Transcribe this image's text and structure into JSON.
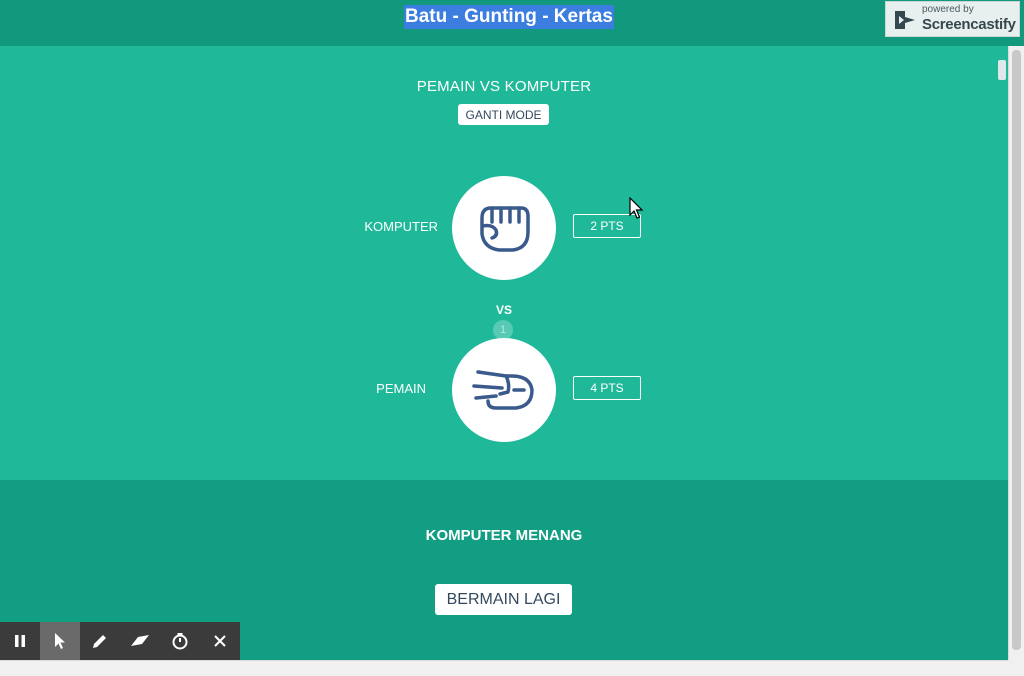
{
  "app": {
    "title": "Batu - Gunting - Kertas"
  },
  "screencastify": {
    "powered_by": "powered by",
    "name": "Screencastify"
  },
  "game": {
    "mode_title": "PEMAIN VS KOMPUTER",
    "mode_button": "GANTI MODE",
    "computer": {
      "label": "KOMPUTER",
      "points": "2 PTS",
      "hand": "rock-fist-icon"
    },
    "vs": "VS",
    "round": "1",
    "player": {
      "label": "PEMAIN",
      "points": "4 PTS",
      "hand": "scissors-hand-icon"
    }
  },
  "result": {
    "text": "KOMPUTER MENANG",
    "play_again": "BERMAIN LAGI"
  },
  "toolbar": {
    "items": [
      "pause-icon",
      "pointer-icon",
      "pen-icon",
      "eraser-icon",
      "timer-icon",
      "close-icon"
    ]
  },
  "colors": {
    "background": "#1fb99a",
    "header": "#12987c",
    "result_area": "#129e83",
    "button_text": "#34495e",
    "hand_stroke": "#3a5a8c"
  }
}
